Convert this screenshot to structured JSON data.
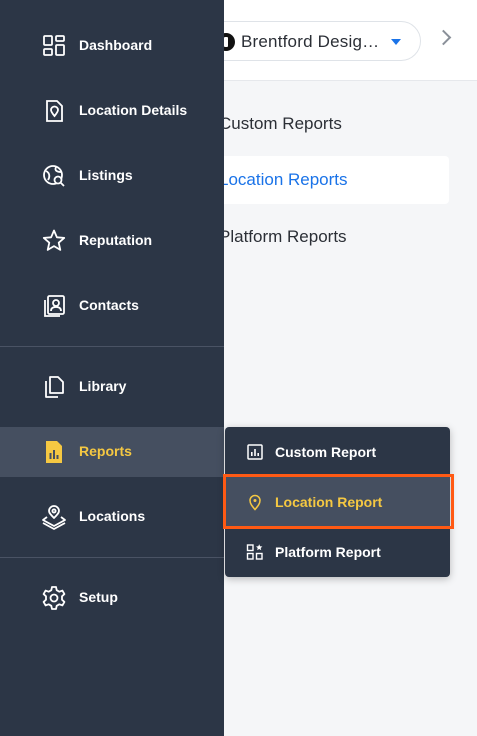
{
  "header": {
    "org_name": "Brentford Desig…",
    "colors": {
      "accent": "#1a73e8",
      "sidebar_bg": "#2c3646",
      "active_bg": "#454f60",
      "active_text": "#f5c842",
      "highlight": "#ff5a14"
    }
  },
  "reports_menu": {
    "items": [
      {
        "label": "Custom Reports",
        "active": false
      },
      {
        "label": "Location Reports",
        "active": true
      },
      {
        "label": "Platform Reports",
        "active": false
      }
    ]
  },
  "sidebar": {
    "items": [
      {
        "label": "Dashboard",
        "icon": "dashboard-icon"
      },
      {
        "label": "Location Details",
        "icon": "location-details-icon"
      },
      {
        "label": "Listings",
        "icon": "listings-icon"
      },
      {
        "label": "Reputation",
        "icon": "star-icon"
      },
      {
        "label": "Contacts",
        "icon": "contacts-icon"
      },
      {
        "label": "Library",
        "icon": "library-icon"
      },
      {
        "label": "Reports",
        "icon": "reports-icon",
        "active": true
      },
      {
        "label": "Locations",
        "icon": "locations-icon"
      },
      {
        "label": "Setup",
        "icon": "gear-icon"
      }
    ]
  },
  "flyout": {
    "items": [
      {
        "label": "Custom Report",
        "icon": "bar-chart-icon"
      },
      {
        "label": "Location Report",
        "icon": "map-pin-icon",
        "active": true
      },
      {
        "label": "Platform Report",
        "icon": "grid-star-icon"
      }
    ]
  }
}
